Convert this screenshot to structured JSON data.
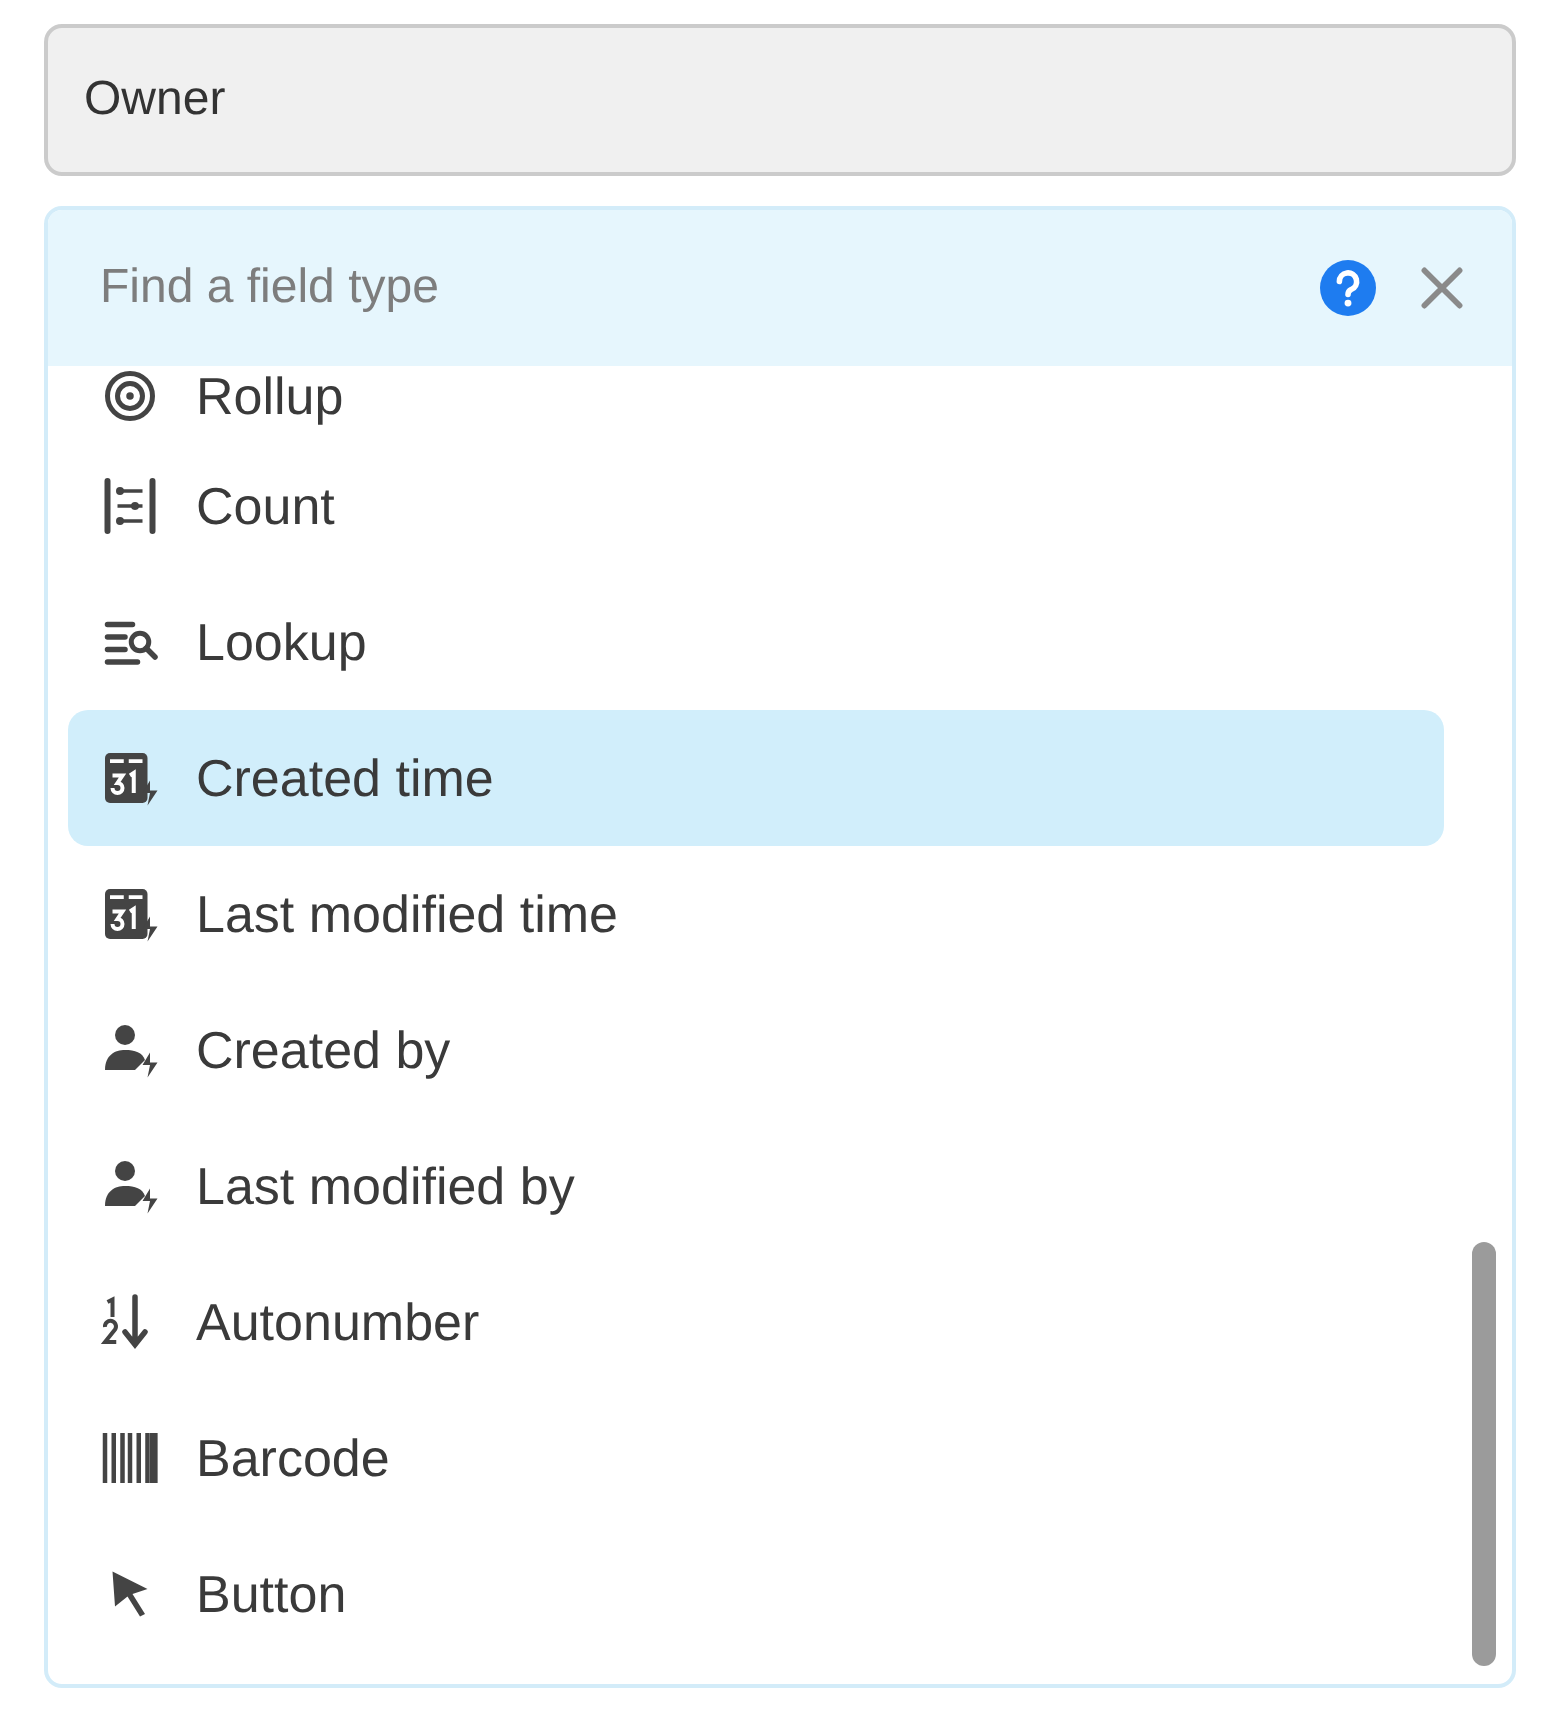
{
  "name_field": {
    "value": "Owner"
  },
  "type_picker": {
    "search": {
      "placeholder": "Find a field type"
    },
    "items": [
      {
        "kind": "rollup",
        "label": "Rollup",
        "selected": false
      },
      {
        "kind": "count",
        "label": "Count",
        "selected": false
      },
      {
        "kind": "lookup",
        "label": "Lookup",
        "selected": false
      },
      {
        "kind": "datetime",
        "label": "Created time",
        "selected": true
      },
      {
        "kind": "datetime",
        "label": "Last modified time",
        "selected": false
      },
      {
        "kind": "user",
        "label": "Created by",
        "selected": false
      },
      {
        "kind": "user",
        "label": "Last modified by",
        "selected": false
      },
      {
        "kind": "autonumber",
        "label": "Autonumber",
        "selected": false
      },
      {
        "kind": "barcode",
        "label": "Barcode",
        "selected": false
      },
      {
        "kind": "button",
        "label": "Button",
        "selected": false
      }
    ]
  }
}
